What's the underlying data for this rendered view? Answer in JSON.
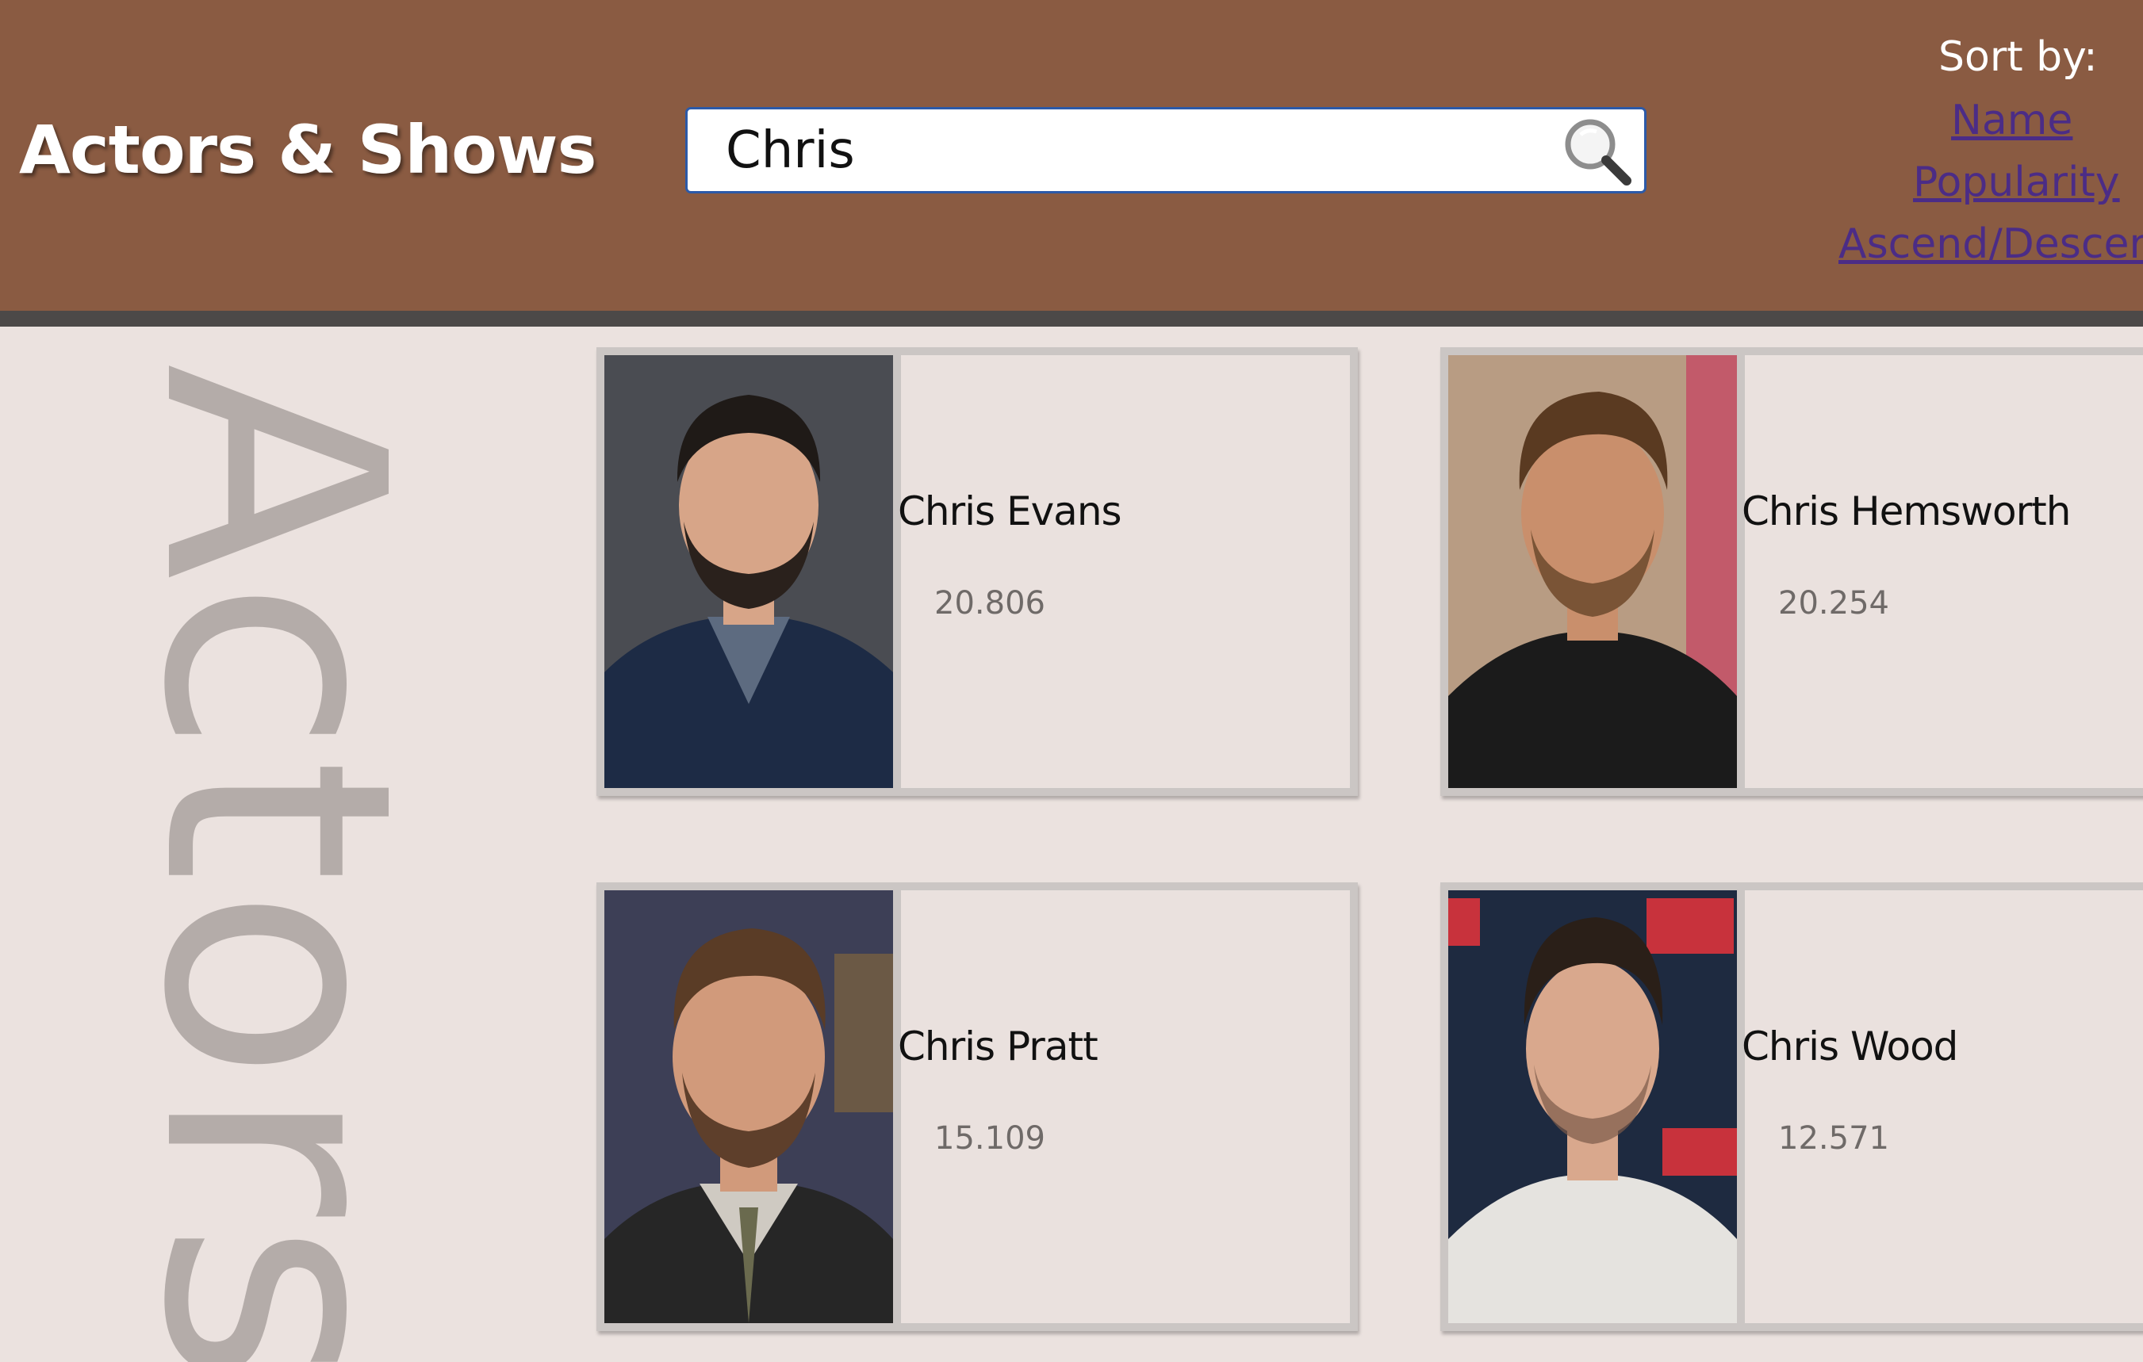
{
  "header": {
    "title": "Actors & Shows",
    "search": {
      "value": "Chris",
      "button_icon": "search-icon"
    },
    "sort": {
      "label": "Sort by:",
      "options": [
        "Name",
        "Popularity",
        "Ascend/Descer"
      ]
    }
  },
  "section_label": "Actors",
  "actors": [
    {
      "name": "Chris Evans",
      "popularity": "20.806",
      "photo_bg": "#4a4c52",
      "skin": "#d7a588",
      "hair": "#1f1a17",
      "outfit": "#1d2b45",
      "shirt": "#5d6b80"
    },
    {
      "name": "Chris Hemsworth",
      "popularity": "20.254",
      "photo_bg": "#b89c83",
      "skin": "#c98f6c",
      "hair": "#5a3a21",
      "outfit": "#1b1b1b",
      "shirt": "#1b1b1b"
    },
    {
      "name": "Chris Pratt",
      "popularity": "15.109",
      "photo_bg": "#3d3f56",
      "skin": "#d19a7b",
      "hair": "#5a3c26",
      "outfit": "#262626",
      "shirt": "#cfcac2"
    },
    {
      "name": "Chris Wood",
      "popularity": "12.571",
      "photo_bg": "#1e2a40",
      "skin": "#d9a88d",
      "hair": "#2a1f18",
      "outfit": "#e5e3df",
      "shirt": "#e5e3df"
    }
  ]
}
